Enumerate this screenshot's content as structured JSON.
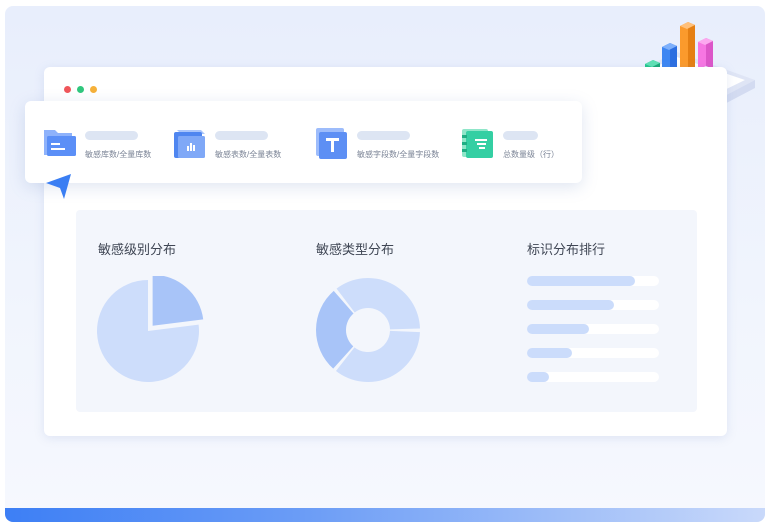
{
  "window": {
    "controls": [
      "close",
      "minimize",
      "maximize"
    ]
  },
  "stats": [
    {
      "label": "敏感库数/全量库数",
      "icon": "database-folder-icon",
      "color": "#5b8ff7"
    },
    {
      "label": "敏感表数/全量表数",
      "icon": "table-chart-icon",
      "color": "#4f86f0"
    },
    {
      "label": "敏感字段数/全量字段数",
      "icon": "text-field-icon",
      "color": "#6b97f5"
    },
    {
      "label": "总数量级（行）",
      "icon": "rows-list-icon",
      "color": "#33cfa2"
    }
  ],
  "charts": {
    "level": {
      "title": "敏感级别分布",
      "chart_data": {
        "type": "pie",
        "values": [
          23,
          77
        ],
        "colors": [
          "#a8c4f8",
          "#cdddfb"
        ]
      }
    },
    "type": {
      "title": "敏感类型分布",
      "chart_data": {
        "type": "pie",
        "values": [
          28,
          36,
          36
        ],
        "colors": [
          "#a8c4f8",
          "#cdddfb",
          "#cdddfb"
        ]
      }
    },
    "rank": {
      "title": "标识分布排行",
      "chart_data": {
        "type": "bar",
        "values": [
          0.82,
          0.66,
          0.47,
          0.34,
          0.17
        ],
        "max": 1
      }
    }
  },
  "colors": {
    "accent": "#3d7ff5",
    "panel": "#f3f6fc",
    "bar_fill": "#cbdcfb"
  }
}
